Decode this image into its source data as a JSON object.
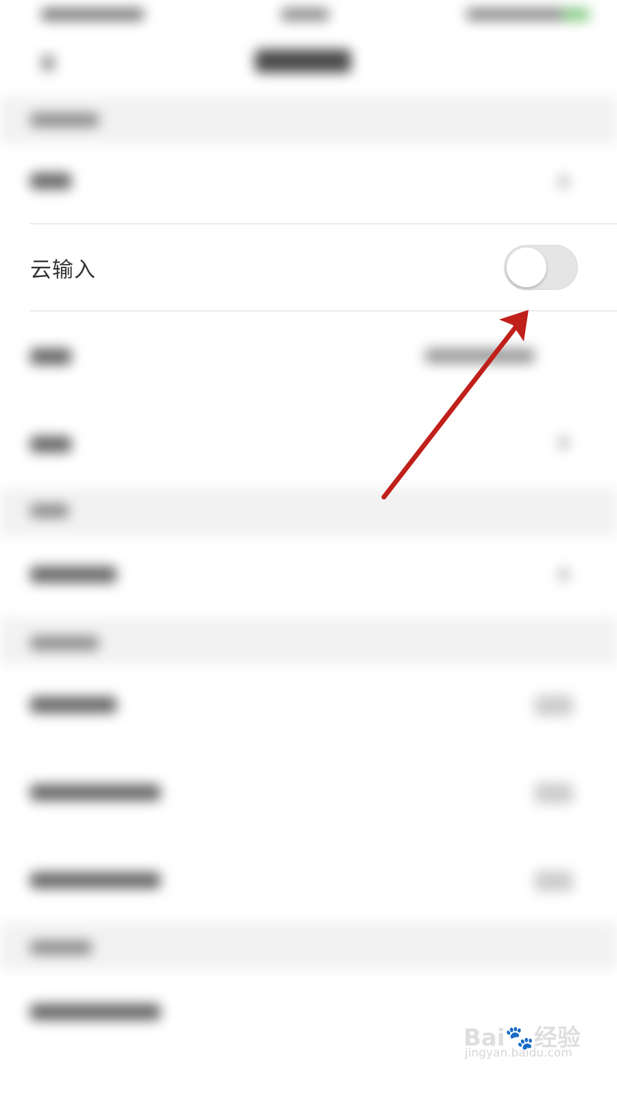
{
  "setting_row": {
    "label": "云输入",
    "enabled": false
  },
  "watermark": {
    "logo": "Bai🐾经验",
    "site": "jingyan.baidu.com"
  },
  "colors": {
    "arrow": "#c0201a",
    "toggle_off": "#e5e5e5",
    "text": "#333333"
  }
}
